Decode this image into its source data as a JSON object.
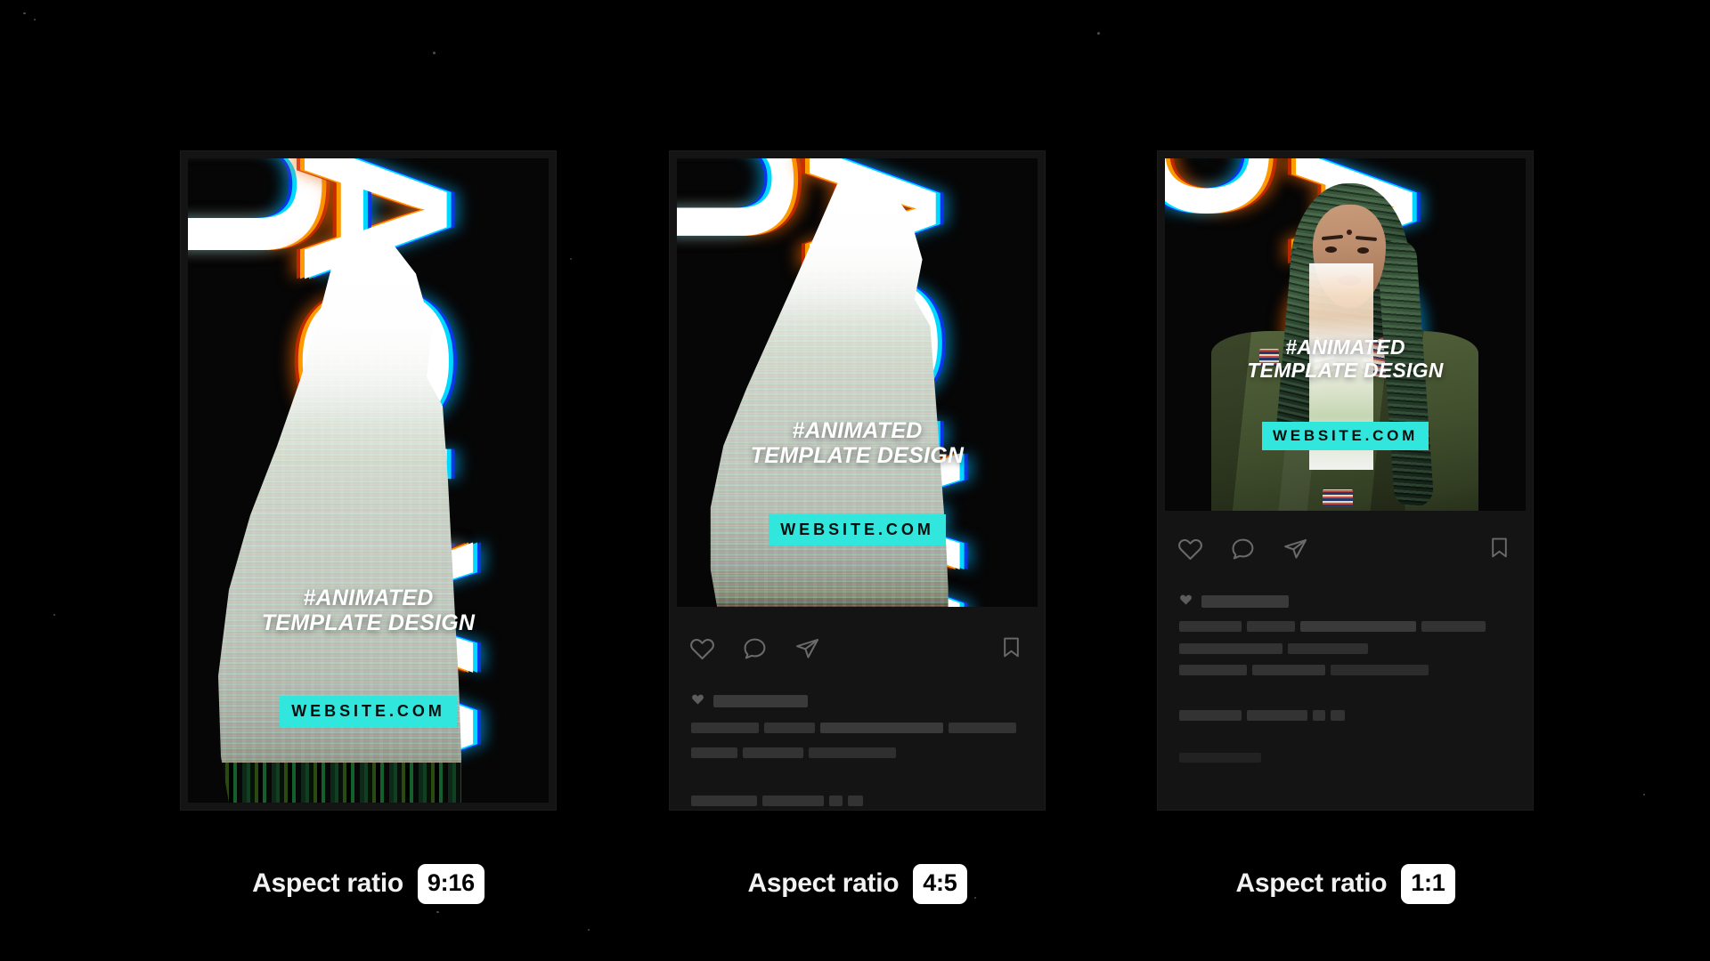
{
  "background": {
    "color": "#000000"
  },
  "theme": {
    "accent_cyan": "#31E7DD",
    "card_surface": "#141414",
    "skeleton_bar": "#333333",
    "caption_text": "#F2F2F2",
    "pill_background": "#FFFFFF",
    "pill_text": "#000000"
  },
  "creative": {
    "headline_line1": "#ANIMATED",
    "headline_line2": "TEMPLATE DESIGN",
    "website_badge": "WEBSITE.COM",
    "background_letters": [
      "URV",
      "AGU",
      "VA",
      "GU",
      "AG",
      "A"
    ]
  },
  "captions": {
    "label": "Aspect ratio"
  },
  "cards": [
    {
      "id": "card-9-16",
      "ratio": "9:16",
      "ratio_label": "Aspect ratio",
      "artwork_subject": "glitched-figure-silhouette",
      "letters": [
        "URV",
        "AGU",
        "VA"
      ],
      "has_instagram_panel": false
    },
    {
      "id": "card-4-5",
      "ratio": "4:5",
      "ratio_label": "Aspect ratio",
      "artwork_subject": "glitched-figure-silhouette",
      "letters": [
        "UR",
        "AGU",
        "VA"
      ],
      "has_instagram_panel": true
    },
    {
      "id": "card-1-1",
      "ratio": "1:1",
      "ratio_label": "Aspect ratio",
      "artwork_subject": "portrait-woman-green-braids",
      "letters": [
        "GU",
        "AG",
        "VA"
      ],
      "has_instagram_panel": true
    }
  ],
  "instagram_actions": {
    "like": "like-heart",
    "comment": "comment-bubble",
    "share": "share-paper-plane",
    "save": "save-bookmark"
  }
}
